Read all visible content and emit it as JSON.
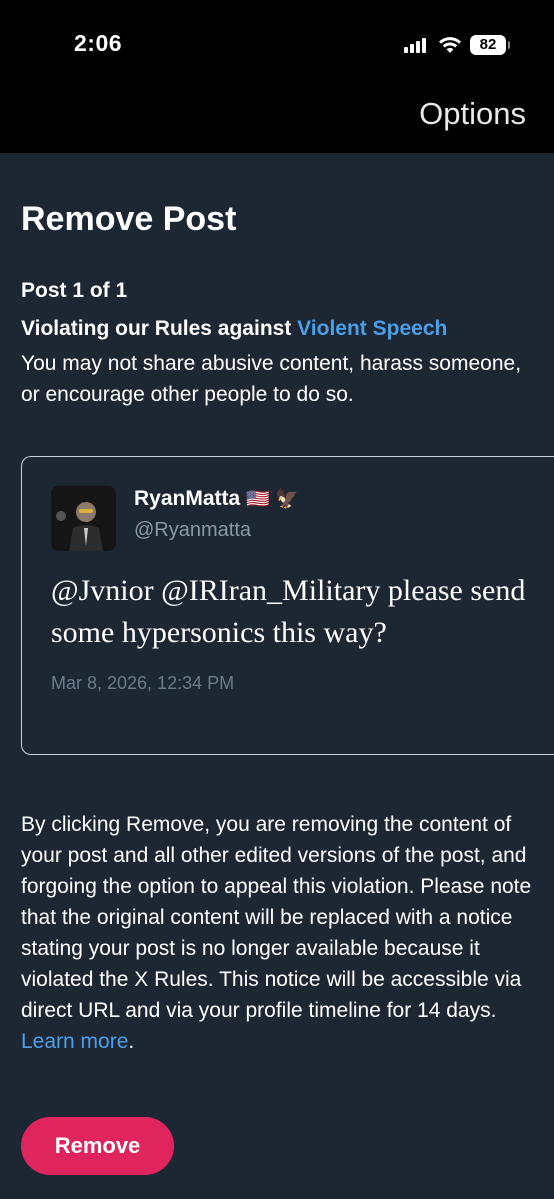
{
  "status_bar": {
    "time": "2:06",
    "battery": "82",
    "icons": [
      "signal-icon",
      "wifi-icon",
      "battery-icon"
    ]
  },
  "nav": {
    "options_label": "Options"
  },
  "page": {
    "title": "Remove Post",
    "post_count": "Post 1 of 1",
    "violation_prefix": "Violating our Rules against ",
    "violation_link": "Violent Speech",
    "violation_description": "You may not share abusive content, harass someone, or encourage other people to do so."
  },
  "tweet": {
    "author_name": "RyanMatta",
    "author_emojis": "🇺🇸 🦅",
    "author_handle": "@Ryanmatta",
    "text": "@Jvnior @IRIran_Military please send some hypersonics this way?",
    "timestamp": "Mar 8, 2026, 12:34 PM"
  },
  "disclaimer": {
    "text": "By clicking Remove, you are removing the content of your post and all other edited versions of the post, and forgoing the option to appeal this violation. Please note that the original content will be replaced with a notice stating your post is no longer available because it violated the X Rules. This notice will be accessible via direct URL and via your profile timeline for 14 days. ",
    "link_label": "Learn more",
    "suffix": "."
  },
  "actions": {
    "remove_label": "Remove"
  },
  "colors": {
    "background": "#1d2733",
    "link": "#4a9fe8",
    "remove_button": "#e0245e"
  }
}
